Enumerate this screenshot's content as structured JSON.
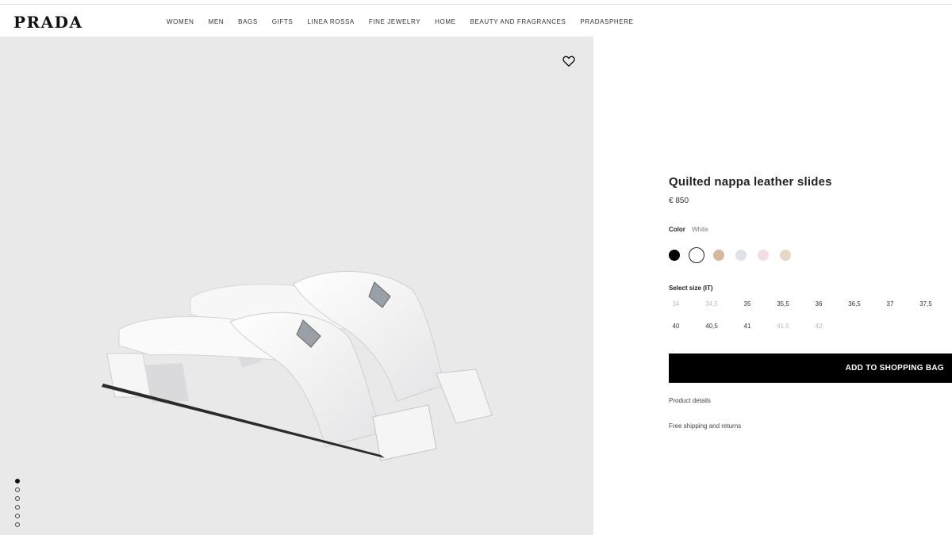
{
  "brand": {
    "logo": "PRADA"
  },
  "nav": {
    "items": [
      "WOMEN",
      "MEN",
      "BAGS",
      "GIFTS",
      "LINEA ROSSA",
      "FINE JEWELRY",
      "HOME",
      "BEAUTY AND FRAGRANCES",
      "PRADASPHERE"
    ]
  },
  "gallery": {
    "wishlist_icon": "heart-icon",
    "image_count": 6,
    "active_index": 0
  },
  "product": {
    "title": "Quilted nappa leather slides",
    "price": "€ 850",
    "color_label": "Color",
    "color_value": "White",
    "swatches": [
      "#000000",
      "#ffffff",
      "#d6b89c",
      "#dfe1e8",
      "#f3dde2",
      "#e6d8c4"
    ],
    "selected_swatch": 1,
    "size_label": "Select size (IT)",
    "sizes_row1": [
      "34",
      "34,5",
      "35",
      "35,5",
      "36",
      "36,5",
      "37",
      "37,5"
    ],
    "sizes_row2": [
      "40",
      "40,5",
      "41",
      "41,5",
      "42"
    ],
    "unavailable_sizes": [
      "34",
      "34,5",
      "41,5",
      "42"
    ],
    "add_to_bag": "ADD TO SHOPPING BAG",
    "product_details": "Product details",
    "shipping": "Free shipping and returns"
  }
}
